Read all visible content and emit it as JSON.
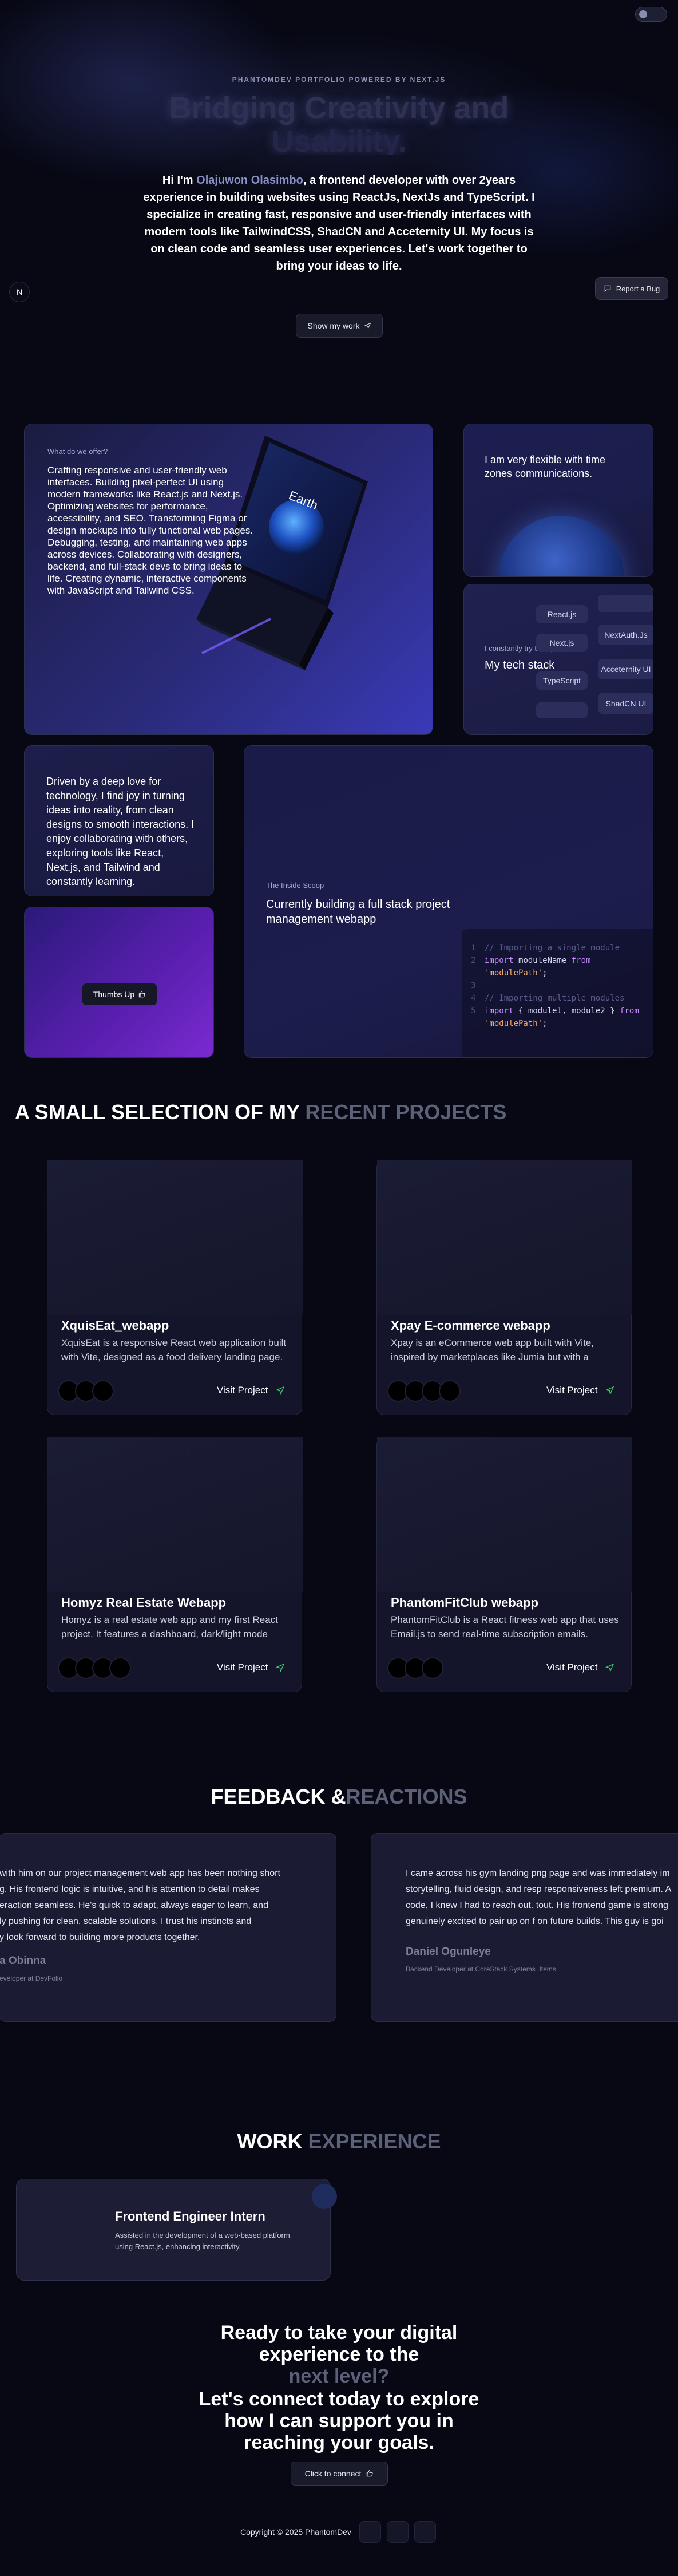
{
  "hero": {
    "eyebrow": "PHANTOMDEV PORTFOLIO POWERED BY NEXT.JS",
    "title_line1": "Bridging Creativity and",
    "title_line2": "Usability.",
    "intro_prefix": "Hi I'm ",
    "intro_name": "Olajuwon Olasimbo",
    "intro_rest": ", a frontend developer with over 2years experience in building websites using ReactJs, NextJs and TypeScript. I specialize in creating fast, responsive and user-friendly interfaces with modern tools like TailwindCSS, ShadCN and Acceternity UI. My focus is on clean code and seamless user experiences. Let's work together to bring your ideas to life.",
    "cta_label": "Show my work",
    "report_bug_label": "Report a Bug",
    "n_badge": "N"
  },
  "bento": {
    "offer": {
      "eyebrow": "What do we offer?",
      "text": "Crafting responsive and user-friendly web interfaces. Building pixel-perfect UI using modern frameworks like React.js and Next.js. Optimizing websites for performance, accessibility, and SEO. Transforming Figma or design mockups into fully functional web pages. Debugging, testing, and maintaining web apps across devices. Collaborating with designers, backend, and full-stack devs to bring ideas to life. Creating dynamic, interactive components with JavaScript and Tailwind CSS.",
      "laptop_screen_title": "Earth"
    },
    "timezone": {
      "text": "I am very flexible with time zones communications."
    },
    "tech": {
      "eyebrow": "I constantly try to improve",
      "title": "My tech stack",
      "pills_left": [
        "React.js",
        "Next.js",
        "TypeScript",
        ""
      ],
      "pills_right": [
        "",
        "NextAuth.Js",
        "Acceternity UI",
        "ShadCN UI"
      ]
    },
    "passion": {
      "text": "Driven by a deep love for technology, I find joy in turning ideas into reality, from clean designs to smooth interactions. I enjoy collaborating with others, exploring tools like React, Next.js, and Tailwind and constantly learning."
    },
    "thumbs": {
      "label": "Thumbs Up"
    },
    "inside_scoop": {
      "eyebrow": "The Inside Scoop",
      "title": "Currently building a full stack project management webapp",
      "code": [
        {
          "ln": "1",
          "parts": [
            [
              "comment",
              "// Importing a single module"
            ]
          ]
        },
        {
          "ln": "2",
          "parts": [
            [
              "kw",
              "import "
            ],
            [
              "id",
              "moduleName "
            ],
            [
              "kw",
              "from"
            ]
          ]
        },
        {
          "ln": "",
          "parts": [
            [
              "str",
              "'modulePath'"
            ],
            [
              "id",
              ";"
            ]
          ]
        },
        {
          "ln": "3",
          "parts": []
        },
        {
          "ln": "4",
          "parts": [
            [
              "comment",
              "// Importing multiple modules"
            ]
          ]
        },
        {
          "ln": "5",
          "parts": [
            [
              "kw",
              "import "
            ],
            [
              "id",
              "{ module1, module2 } "
            ],
            [
              "kw",
              "from"
            ]
          ]
        },
        {
          "ln": "",
          "parts": [
            [
              "str",
              "'modulePath'"
            ],
            [
              "id",
              ";"
            ]
          ]
        }
      ]
    }
  },
  "projects": {
    "title_main": "A SMALL SELECTION OF MY ",
    "title_muted": "RECENT PROJECTS",
    "items": [
      {
        "title": "XquisEat_webapp",
        "desc": "XquisEat is a responsive React web application built with Vite, designed as a food delivery landing page.",
        "link": "Visit Project",
        "icons": 3
      },
      {
        "title": "Xpay E-commerce webapp",
        "desc": "Xpay is an eCommerce web app built with Vite, inspired by marketplaces like Jumia but with a modern twist.",
        "link": "Visit Project",
        "icons": 4
      },
      {
        "title": "Homyz Real Estate Webapp",
        "desc": "Homyz is a real estate web app and my first React project. It features a dashboard, dark/light mode toggle.",
        "link": "Visit Project",
        "icons": 4
      },
      {
        "title": "PhantomFitClub webapp",
        "desc": "PhantomFitClub is a React fitness web app that uses Email.js to send real-time subscription emails.",
        "link": "Visit Project",
        "icons": 3
      }
    ]
  },
  "feedback": {
    "title_main": "FEEDBACK &",
    "title_muted": "REACTIONS",
    "items": [
      {
        "lines": [
          "with him on our project management web app has been nothing short",
          "g. His frontend logic is intuitive, and his attention to detail makes",
          "eraction seamless. He's quick to adapt, always eager to learn, and",
          "ly pushing for clean, scalable solutions. I trust his instincts and",
          "y look forward to building more products together."
        ],
        "name": "a Obinna",
        "role": "eveloper at DevFolio"
      },
      {
        "lines": [
          "I came across his gym landing png page and was immediately im",
          "storytelling, fluid design, and resp responsiveness left premium. A",
          "code, I knew I had to reach out. tout. His frontend game is strong",
          "genuinely excited to pair up on f on future builds. This guy is goi"
        ],
        "name": "Daniel Ogunleye",
        "role": "Backend Developer at CoreStack Systems .Items"
      }
    ]
  },
  "experience": {
    "title_main": "WORK ",
    "title_muted": "EXPERIENCE",
    "items": [
      {
        "title": "Frontend Engineer Intern",
        "desc": "Assisted in the development of a web-based platform using React.js, enhancing interactivity."
      }
    ]
  },
  "cta": {
    "line1": "Ready to take your digital",
    "line2": "experience to the",
    "line3_muted": "next level?",
    "line4": "Let's connect today to explore",
    "line5": "how I can support you in",
    "line6": "reaching your goals.",
    "button": "Click to connect"
  },
  "footer": {
    "copyright": "Copyright © 2025 PhantomDev",
    "socials": [
      "github-icon",
      "twitter-icon",
      "linkedin-icon"
    ]
  },
  "colors": {
    "background": "#070814",
    "accent_name": "#8a8fc6",
    "muted_heading": "#5d6178",
    "visit_icon": "#3ccf6a"
  }
}
